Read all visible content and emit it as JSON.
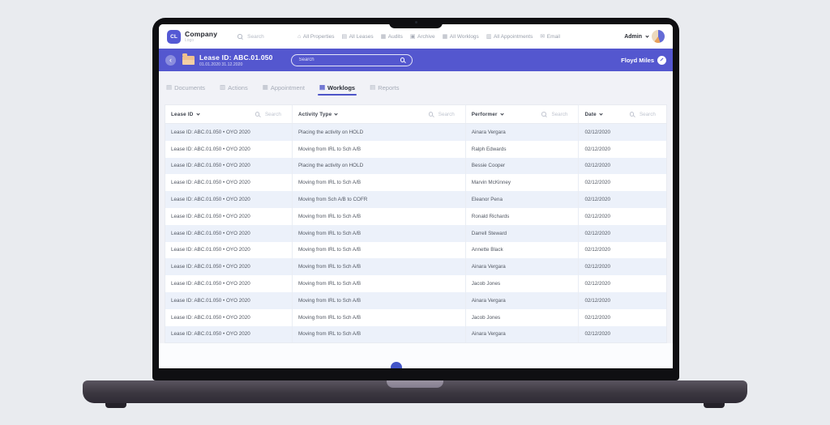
{
  "navbar": {
    "logo_badge": "CL",
    "logo_title": "Company",
    "logo_subtitle": "Logo",
    "search_placeholder": "Search",
    "items": [
      {
        "name": "nav-all-properties",
        "label": "All Properties",
        "icon": "home-icon"
      },
      {
        "name": "nav-all-leases",
        "label": "All Leases",
        "icon": "leases-icon"
      },
      {
        "name": "nav-audits",
        "label": "Audits",
        "icon": "audits-icon"
      },
      {
        "name": "nav-archive",
        "label": "Archive",
        "icon": "archive-icon"
      },
      {
        "name": "nav-all-worklogs",
        "label": "All Worklogs",
        "icon": "worklogs-icon"
      },
      {
        "name": "nav-all-appointments",
        "label": "All Appointments",
        "icon": "appointments-icon"
      },
      {
        "name": "nav-email",
        "label": "Email",
        "icon": "email-icon"
      }
    ],
    "admin_label": "Admin"
  },
  "lease_header": {
    "title": "Lease ID: ABC.01.050",
    "date_range": "01.01.2020 31.12.2020",
    "search_placeholder": "Search",
    "assignee": "Floyd Miles"
  },
  "tabs": [
    {
      "name": "tab-documents",
      "label": "Documents",
      "icon": "documents-icon",
      "active": false
    },
    {
      "name": "tab-actions",
      "label": "Actions",
      "icon": "actions-icon",
      "active": false
    },
    {
      "name": "tab-appointment",
      "label": "Appointment",
      "icon": "appointment-icon",
      "active": false
    },
    {
      "name": "tab-worklogs",
      "label": "Worklogs",
      "icon": "worklogs-tab-icon",
      "active": true
    },
    {
      "name": "tab-reports",
      "label": "Reports",
      "icon": "reports-icon",
      "active": false
    }
  ],
  "table": {
    "columns": [
      {
        "name": "column-header-lease-id",
        "label": "Lease ID",
        "search_placeholder": "Search"
      },
      {
        "name": "column-header-activity-type",
        "label": "Activity Type",
        "search_placeholder": "Search"
      },
      {
        "name": "column-header-performer",
        "label": "Performer",
        "search_placeholder": "Search"
      },
      {
        "name": "column-header-date",
        "label": "Date",
        "search_placeholder": "Search"
      }
    ],
    "rows": [
      [
        "Lease ID: ABC.01.050 • OYO 2020",
        "Placing the activity on HOLD",
        "Ainara Vergara",
        "02/12/2020"
      ],
      [
        "Lease ID: ABC.01.050 • OYO 2020",
        "Moving from IRL to Sch A/B",
        "Ralph Edwards",
        "02/12/2020"
      ],
      [
        "Lease ID: ABC.01.050 • OYO 2020",
        "Placing the activity on HOLD",
        "Bessie Cooper",
        "02/12/2020"
      ],
      [
        "Lease ID: ABC.01.050 • OYO 2020",
        "Moving from IRL to Sch A/B",
        "Marvin McKinney",
        "02/12/2020"
      ],
      [
        "Lease ID: ABC.01.050 • OYO 2020",
        "Moving from Sch A/B to COFR",
        "Eleanor Pena",
        "02/12/2020"
      ],
      [
        "Lease ID: ABC.01.050 • OYO 2020",
        "Moving from IRL to Sch A/B",
        "Ronald Richards",
        "02/12/2020"
      ],
      [
        "Lease ID: ABC.01.050 • OYO 2020",
        "Moving from IRL to Sch A/B",
        "Darrell Steward",
        "02/12/2020"
      ],
      [
        "Lease ID: ABC.01.050 • OYO 2020",
        "Moving from IRL to Sch A/B",
        "Annette Black",
        "02/12/2020"
      ],
      [
        "Lease ID: ABC.01.050 • OYO 2020",
        "Moving from IRL to Sch A/B",
        "Ainara Vergara",
        "02/12/2020"
      ],
      [
        "Lease ID: ABC.01.050 • OYO 2020",
        "Moving from IRL to Sch A/B",
        "Jacob Jones",
        "02/12/2020"
      ],
      [
        "Lease ID: ABC.01.050 • OYO 2020",
        "Moving from IRL to Sch A/B",
        "Ainara Vergara",
        "02/12/2020"
      ],
      [
        "Lease ID: ABC.01.050 • OYO 2020",
        "Moving from IRL to Sch A/B",
        "Jacob Jones",
        "02/12/2020"
      ],
      [
        "Lease ID: ABC.01.050 • OYO 2020",
        "Moving from IRL to Sch A/B",
        "Ainara Vergara",
        "02/12/2020"
      ]
    ]
  },
  "colors": {
    "accent_purple": "#5457cf",
    "active_tab": "#4d54c8",
    "row_stripe": "#ecf1fa",
    "scroll_dot": "#4355c8",
    "folder": "#eec08f",
    "logo_badge": "#5459d4"
  }
}
